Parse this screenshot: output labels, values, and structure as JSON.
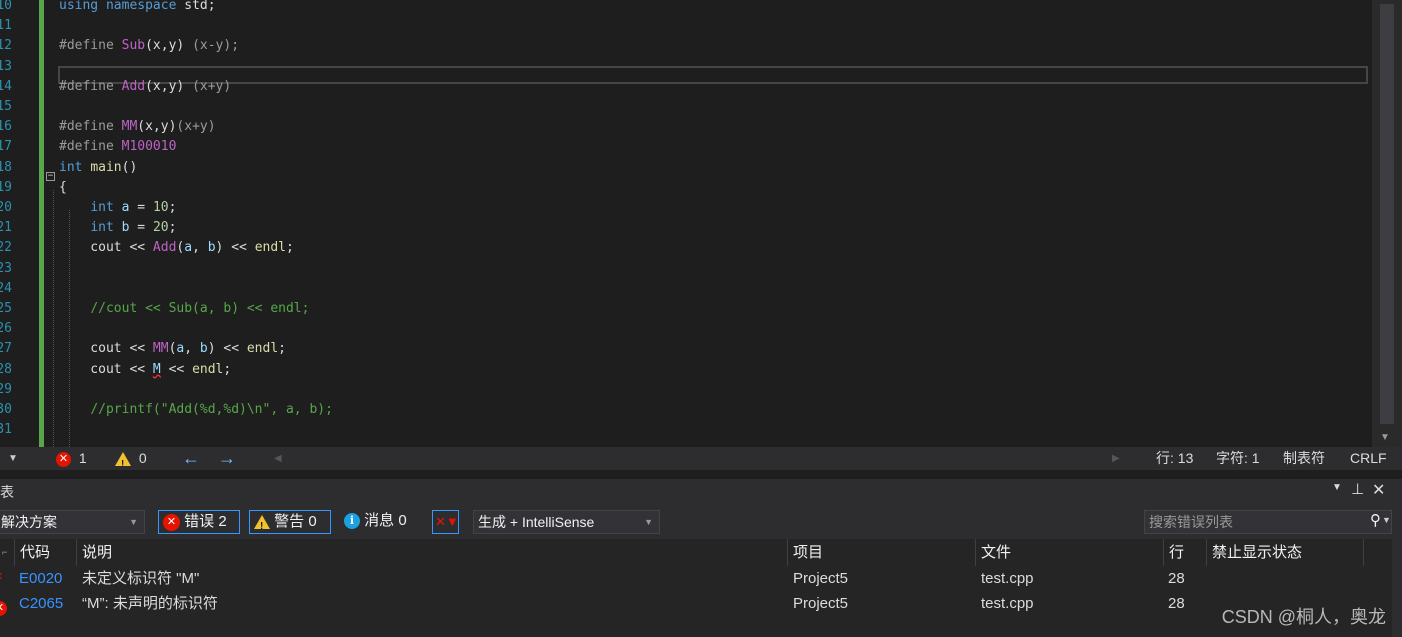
{
  "editor": {
    "line_numbers": [
      "10",
      "11",
      "12",
      "13",
      "14",
      "15",
      "16",
      "17",
      "18",
      "19",
      "20",
      "21",
      "22",
      "23",
      "24",
      "25",
      "26",
      "27",
      "28",
      "29",
      "30",
      "31"
    ],
    "lines": [
      [
        {
          "c": "kw",
          "t": "using"
        },
        {
          "c": "",
          "t": " "
        },
        {
          "c": "kw",
          "t": "namespace"
        },
        {
          "c": "",
          "t": " std;"
        }
      ],
      [],
      [
        {
          "c": "pp",
          "t": "#define "
        },
        {
          "c": "mac",
          "t": "Sub"
        },
        {
          "c": "",
          "t": "(x,y) "
        },
        {
          "c": "pp",
          "t": "(x-y);"
        }
      ],
      [],
      [
        {
          "c": "pp",
          "t": "#define "
        },
        {
          "c": "mac",
          "t": "Add"
        },
        {
          "c": "",
          "t": "(x,y) "
        },
        {
          "c": "pp",
          "t": "(x+y)"
        }
      ],
      [],
      [
        {
          "c": "pp",
          "t": "#define "
        },
        {
          "c": "mac",
          "t": "MM"
        },
        {
          "c": "",
          "t": "(x,y)"
        },
        {
          "c": "pp",
          "t": "(x+y)"
        }
      ],
      [
        {
          "c": "pp",
          "t": "#define "
        },
        {
          "c": "mac",
          "t": "M100010"
        }
      ],
      [
        {
          "c": "kw",
          "t": "int"
        },
        {
          "c": "",
          "t": " "
        },
        {
          "c": "fn",
          "t": "main"
        },
        {
          "c": "",
          "t": "()"
        }
      ],
      [
        {
          "c": "",
          "t": "{"
        }
      ],
      [
        {
          "c": "",
          "t": "    "
        },
        {
          "c": "kw",
          "t": "int"
        },
        {
          "c": "",
          "t": " "
        },
        {
          "c": "var",
          "t": "a"
        },
        {
          "c": "",
          "t": " = "
        },
        {
          "c": "num",
          "t": "10"
        },
        {
          "c": "",
          "t": ";"
        }
      ],
      [
        {
          "c": "",
          "t": "    "
        },
        {
          "c": "kw",
          "t": "int"
        },
        {
          "c": "",
          "t": " "
        },
        {
          "c": "var",
          "t": "b"
        },
        {
          "c": "",
          "t": " = "
        },
        {
          "c": "num",
          "t": "20"
        },
        {
          "c": "",
          "t": ";"
        }
      ],
      [
        {
          "c": "",
          "t": "    cout << "
        },
        {
          "c": "mac",
          "t": "Add"
        },
        {
          "c": "",
          "t": "("
        },
        {
          "c": "var",
          "t": "a"
        },
        {
          "c": "",
          "t": ", "
        },
        {
          "c": "var",
          "t": "b"
        },
        {
          "c": "",
          "t": ") << "
        },
        {
          "c": "fn",
          "t": "endl"
        },
        {
          "c": "",
          "t": ";"
        }
      ],
      [],
      [],
      [
        {
          "c": "",
          "t": "    "
        },
        {
          "c": "cm",
          "t": "//cout << Sub(a, b) << endl;"
        }
      ],
      [],
      [
        {
          "c": "",
          "t": "    cout << "
        },
        {
          "c": "mac",
          "t": "MM"
        },
        {
          "c": "",
          "t": "("
        },
        {
          "c": "var",
          "t": "a"
        },
        {
          "c": "",
          "t": ", "
        },
        {
          "c": "var",
          "t": "b"
        },
        {
          "c": "",
          "t": ") << "
        },
        {
          "c": "fn",
          "t": "endl"
        },
        {
          "c": "",
          "t": ";"
        }
      ],
      [
        {
          "c": "",
          "t": "    cout << "
        },
        {
          "c": "var squiggle",
          "t": "M"
        },
        {
          "c": "",
          "t": " << "
        },
        {
          "c": "fn",
          "t": "endl"
        },
        {
          "c": "",
          "t": ";"
        }
      ],
      [],
      [
        {
          "c": "",
          "t": "    "
        },
        {
          "c": "cm",
          "t": "//printf(\"Add(%d,%d)\\n\", a, b);"
        }
      ],
      []
    ]
  },
  "status": {
    "errors": "1",
    "warnings": "0",
    "line": "行: 13",
    "char": "字符: 1",
    "indent": "制表符",
    "eol": "CRLF"
  },
  "panel": {
    "title": "表",
    "scope": "解决方案",
    "errors_btn": "错误 2",
    "warnings_btn": "警告 0",
    "messages_btn": "消息 0",
    "build_filter": "生成 + IntelliSense",
    "search_placeholder": "搜索错误列表"
  },
  "table": {
    "headers": [
      "代码",
      "说明",
      "项目",
      "文件",
      "行",
      "禁止显示状态"
    ],
    "rows": [
      {
        "code": "E0020",
        "desc": "未定义标识符 \"M\"",
        "project": "Project5",
        "file": "test.cpp",
        "line": "28",
        "suppress": ""
      },
      {
        "code": "C2065",
        "desc": "“M”: 未声明的标识符",
        "project": "Project5",
        "file": "test.cpp",
        "line": "28",
        "suppress": ""
      }
    ]
  },
  "watermark": "CSDN @桐人，奥龙",
  "colors": {
    "error": "#e51400",
    "warning": "#f2c12e",
    "info": "#1ba1e2",
    "accent": "#3399ff",
    "link": "#3794ff"
  }
}
